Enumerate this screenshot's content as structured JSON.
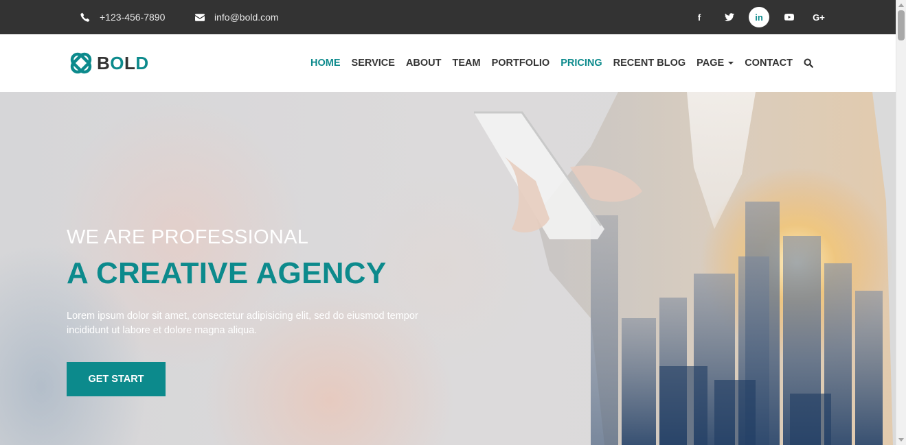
{
  "topbar": {
    "phone": "+123-456-7890",
    "email": "info@bold.com",
    "socials": [
      {
        "name": "facebook-icon",
        "label": "f"
      },
      {
        "name": "twitter-icon",
        "label": ""
      },
      {
        "name": "linkedin-icon",
        "label": "in",
        "active": true
      },
      {
        "name": "youtube-icon",
        "label": ""
      },
      {
        "name": "google-plus-icon",
        "label": "G+"
      }
    ]
  },
  "brand": {
    "name_part1": "B",
    "name_part2": "O",
    "name_part3": "L",
    "name_part4": "D"
  },
  "nav": {
    "items": [
      {
        "label": "HOME",
        "active": true
      },
      {
        "label": "SERVICE"
      },
      {
        "label": "ABOUT"
      },
      {
        "label": "TEAM"
      },
      {
        "label": "PORTFOLIO"
      },
      {
        "label": "PRICING",
        "active": true
      },
      {
        "label": "RECENT BLOG"
      },
      {
        "label": "PAGE",
        "dropdown": true
      },
      {
        "label": "CONTACT"
      }
    ]
  },
  "hero": {
    "subtitle": "WE ARE PROFESSIONAL",
    "title": "A CREATIVE AGENCY",
    "text": "Lorem ipsum dolor sit amet, consectetur adipisicing elit, sed do eiusmod tempor incididunt ut labore et dolore magna aliqua.",
    "cta_label": "GET START"
  },
  "colors": {
    "accent": "#0c8a8c",
    "topbar_bg": "#333333",
    "text_dark": "#333333"
  }
}
